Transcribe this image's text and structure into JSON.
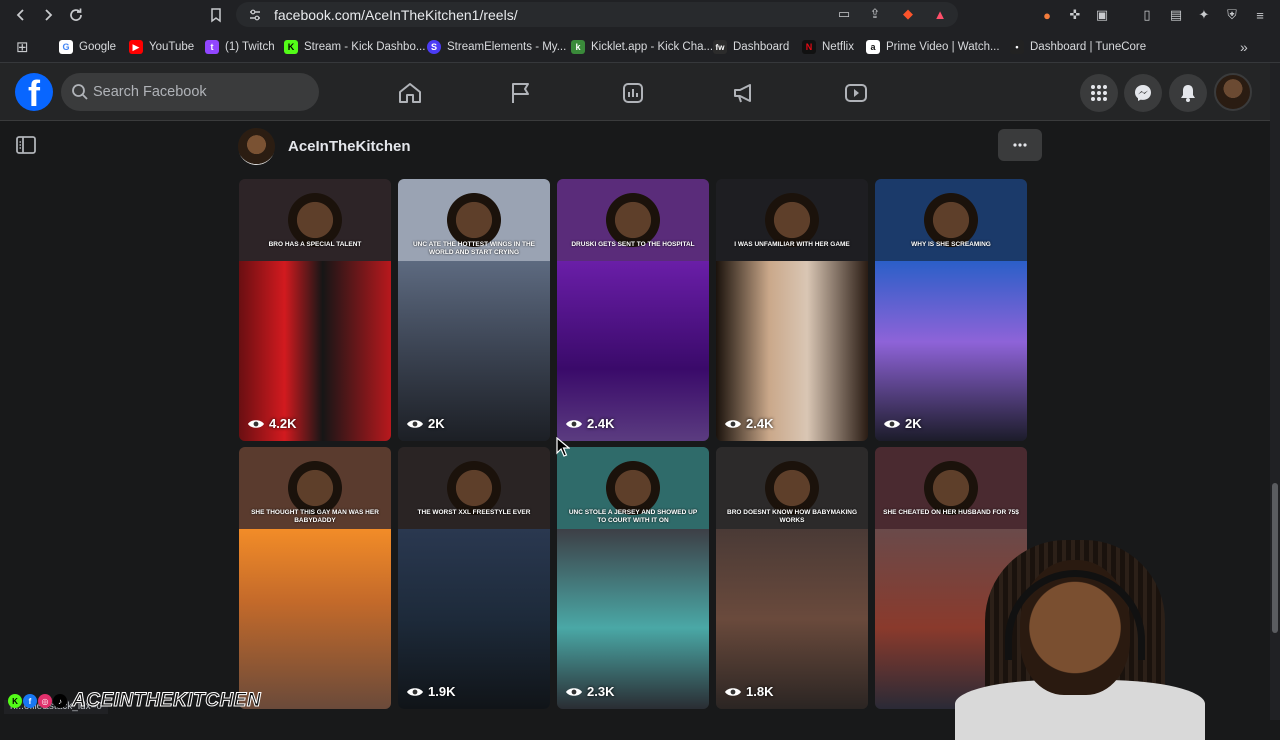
{
  "browser": {
    "url": "facebook.com/AceInTheKitchen1/reels/",
    "bookmarks": [
      {
        "label": "Google",
        "color": "#4285f4",
        "glyph": "G"
      },
      {
        "label": "YouTube",
        "color": "#ff0000",
        "glyph": "▶"
      },
      {
        "label": "(1) Twitch",
        "color": "#9146ff",
        "glyph": "t"
      },
      {
        "label": "Stream - Kick Dashbo...",
        "color": "#53fc18",
        "glyph": "K"
      },
      {
        "label": "StreamElements - My...",
        "color": "#4b3cf5",
        "glyph": "S"
      },
      {
        "label": "Kicklet.app - Kick Cha...",
        "color": "#3a8a3a",
        "glyph": "k"
      },
      {
        "label": "Dashboard",
        "color": "#2c2c2c",
        "glyph": "fw"
      },
      {
        "label": "Netflix",
        "color": "#e50914",
        "glyph": "N"
      },
      {
        "label": "Prime Video | Watch...",
        "color": "#ffffff",
        "glyph": "a"
      },
      {
        "label": "Dashboard | TuneCore",
        "color": "#222222",
        "glyph": "•"
      }
    ],
    "status_text": "h...ofile&stack_idx=0"
  },
  "header": {
    "search_placeholder": "Search Facebook"
  },
  "profile": {
    "name": "AceInTheKitchen"
  },
  "reels": [
    {
      "caption": "BRO HAS A SPECIAL TALENT",
      "views": "4.2K",
      "top": "#2d2427",
      "bottom": "linear-gradient(90deg,#6a0f12 0%,#d21a1f 30%,#161616 55%,#b8181d 100%)"
    },
    {
      "caption": "UNC ATE THE HOTTEST WINGS IN THE WORLD AND START CRYING",
      "views": "2K",
      "top": "#9aa3b3",
      "bottom": "linear-gradient(180deg,#5d6a80 0%,#3b4352 50%,#1c1f25 100%)"
    },
    {
      "caption": "DRUSKI GETS SENT TO THE HOSPITAL",
      "views": "2.4K",
      "top": "#5a2c7a",
      "bottom": "linear-gradient(180deg,#6a1ea8 0%,#3a0a6a 60%,#5b3c80 100%)"
    },
    {
      "caption": "I WAS UNFAMILIAR WITH HER GAME",
      "views": "2.4K",
      "top": "#1e1e22",
      "bottom": "linear-gradient(90deg,#1a120c 0%,#caa88a 35%,#d9c6b4 60%,#2a1c14 100%)"
    },
    {
      "caption": "WHY IS SHE SCREAMING",
      "views": "2K",
      "top": "#1b3a6a",
      "bottom": "linear-gradient(180deg,#2b5fc8 0%,#8e63d8 45%,#1c1c2a 100%)"
    },
    {
      "caption": "SHE THOUGHT THIS GAY MAN WAS HER BABYDADDY",
      "views": "",
      "top": "#5a3b2e",
      "bottom": "linear-gradient(180deg,#f28c28 0%,#c46a2a 40%,#6a4a3a 100%)"
    },
    {
      "caption": "THE WORST XXL FREESTYLE EVER",
      "views": "1.9K",
      "top": "#2a2424",
      "bottom": "linear-gradient(180deg,#2a3850 0%,#1d2a3a 50%,#101418 100%)"
    },
    {
      "caption": "UNC STOLE A JERSEY AND SHOWED UP TO COURT WITH IT ON",
      "views": "2.3K",
      "top": "#2f6b6a",
      "bottom": "linear-gradient(180deg,#3d3f46 0%,#4aa8a6 55%,#2a2d33 100%)"
    },
    {
      "caption": "BRO DOESNT KNOW HOW BABYMAKING WORKS",
      "views": "1.8K",
      "top": "#2c2a2a",
      "bottom": "linear-gradient(180deg,#4a3a36 0%,#6a4a3c 50%,#2b2523 100%)"
    },
    {
      "caption": "SHE CHEATED ON HER HUSBAND FOR 75$",
      "views": "",
      "top": "#4a2a30",
      "bottom": "linear-gradient(180deg,#6a4a4a 0%,#8a3a2c 55%,#2a2a36 100%)"
    }
  ],
  "overlay": {
    "watermark": "ACEINTHEKITCHEN"
  }
}
